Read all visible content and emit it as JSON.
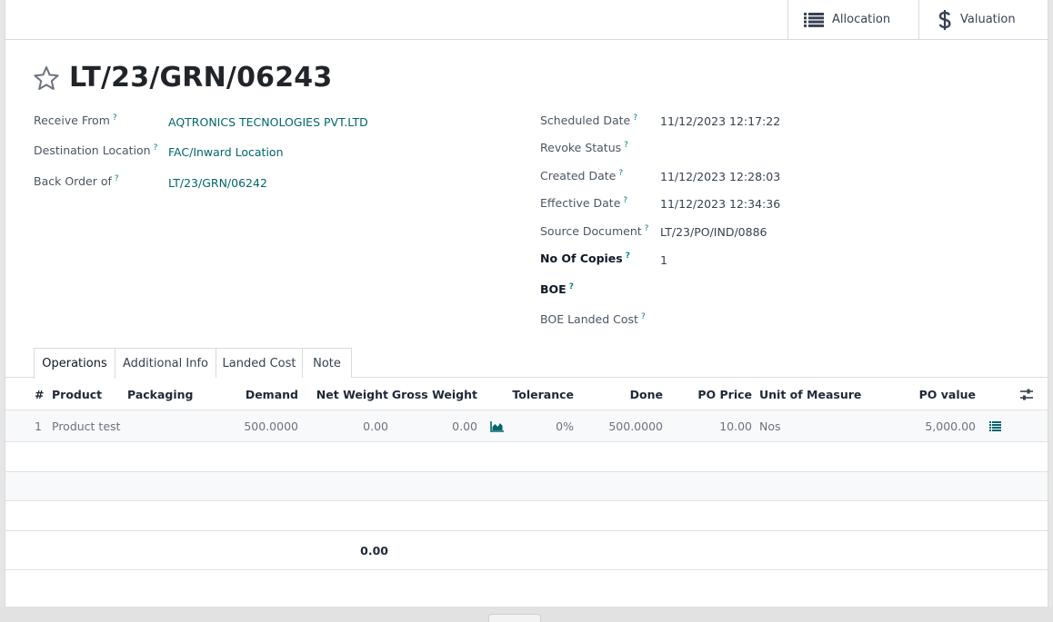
{
  "smart_buttons": {
    "allocation_label": "Allocation",
    "allocation_icon": "list-icon",
    "valuation_label": "Valuation",
    "valuation_icon": "dollar-icon"
  },
  "record": {
    "title": "LT/23/GRN/06243",
    "favorite_icon": "star-icon"
  },
  "fields_left": {
    "receive_from_label": "Receive From",
    "receive_from_value": "AQTRONICS TECNOLOGIES PVT.LTD",
    "destination_label": "Destination Location",
    "destination_value": "FAC/Inward Location",
    "back_order_label": "Back Order of",
    "back_order_value": "LT/23/GRN/06242",
    "help_mark": "?"
  },
  "fields_right": {
    "scheduled_date_label": "Scheduled Date",
    "scheduled_date_value": "11/12/2023 12:17:22",
    "revoke_status_label": "Revoke Status",
    "created_date_label": "Created Date",
    "created_date_value": "11/12/2023 12:28:03",
    "effective_date_label": "Effective Date",
    "effective_date_value": "11/12/2023 12:34:36",
    "source_document_label": "Source Document",
    "source_document_value": "LT/23/PO/IND/0886",
    "copies_label": "No Of Copies",
    "copies_value": "1",
    "boe_label": "BOE",
    "boe_landed_cost_label": "BOE Landed Cost"
  },
  "tabs": {
    "operations": "Operations",
    "additional_info": "Additional Info",
    "landed_cost": "Landed Cost",
    "note": "Note"
  },
  "table": {
    "headers": {
      "num": "#",
      "product": "Product",
      "packaging": "Packaging",
      "demand": "Demand",
      "net_weight": "Net Weight",
      "gross_weight": "Gross Weight",
      "tolerance": "Tolerance",
      "done": "Done",
      "po_price": "PO Price",
      "uom": "Unit of Measure",
      "po_value": "PO value"
    },
    "rows": [
      {
        "num": "1",
        "product": "Product test",
        "demand": "500.0000",
        "net_weight": "0.00",
        "gross_weight": "0.00",
        "tolerance": "0%",
        "done": "500.0000",
        "po_price": "10.00",
        "uom": "Nos",
        "po_value": "5,000.00"
      }
    ],
    "footer_net_weight": "0.00"
  },
  "colors": {
    "link": "#01666b",
    "help_mark": "#017e84",
    "border": "#d8dadd"
  }
}
